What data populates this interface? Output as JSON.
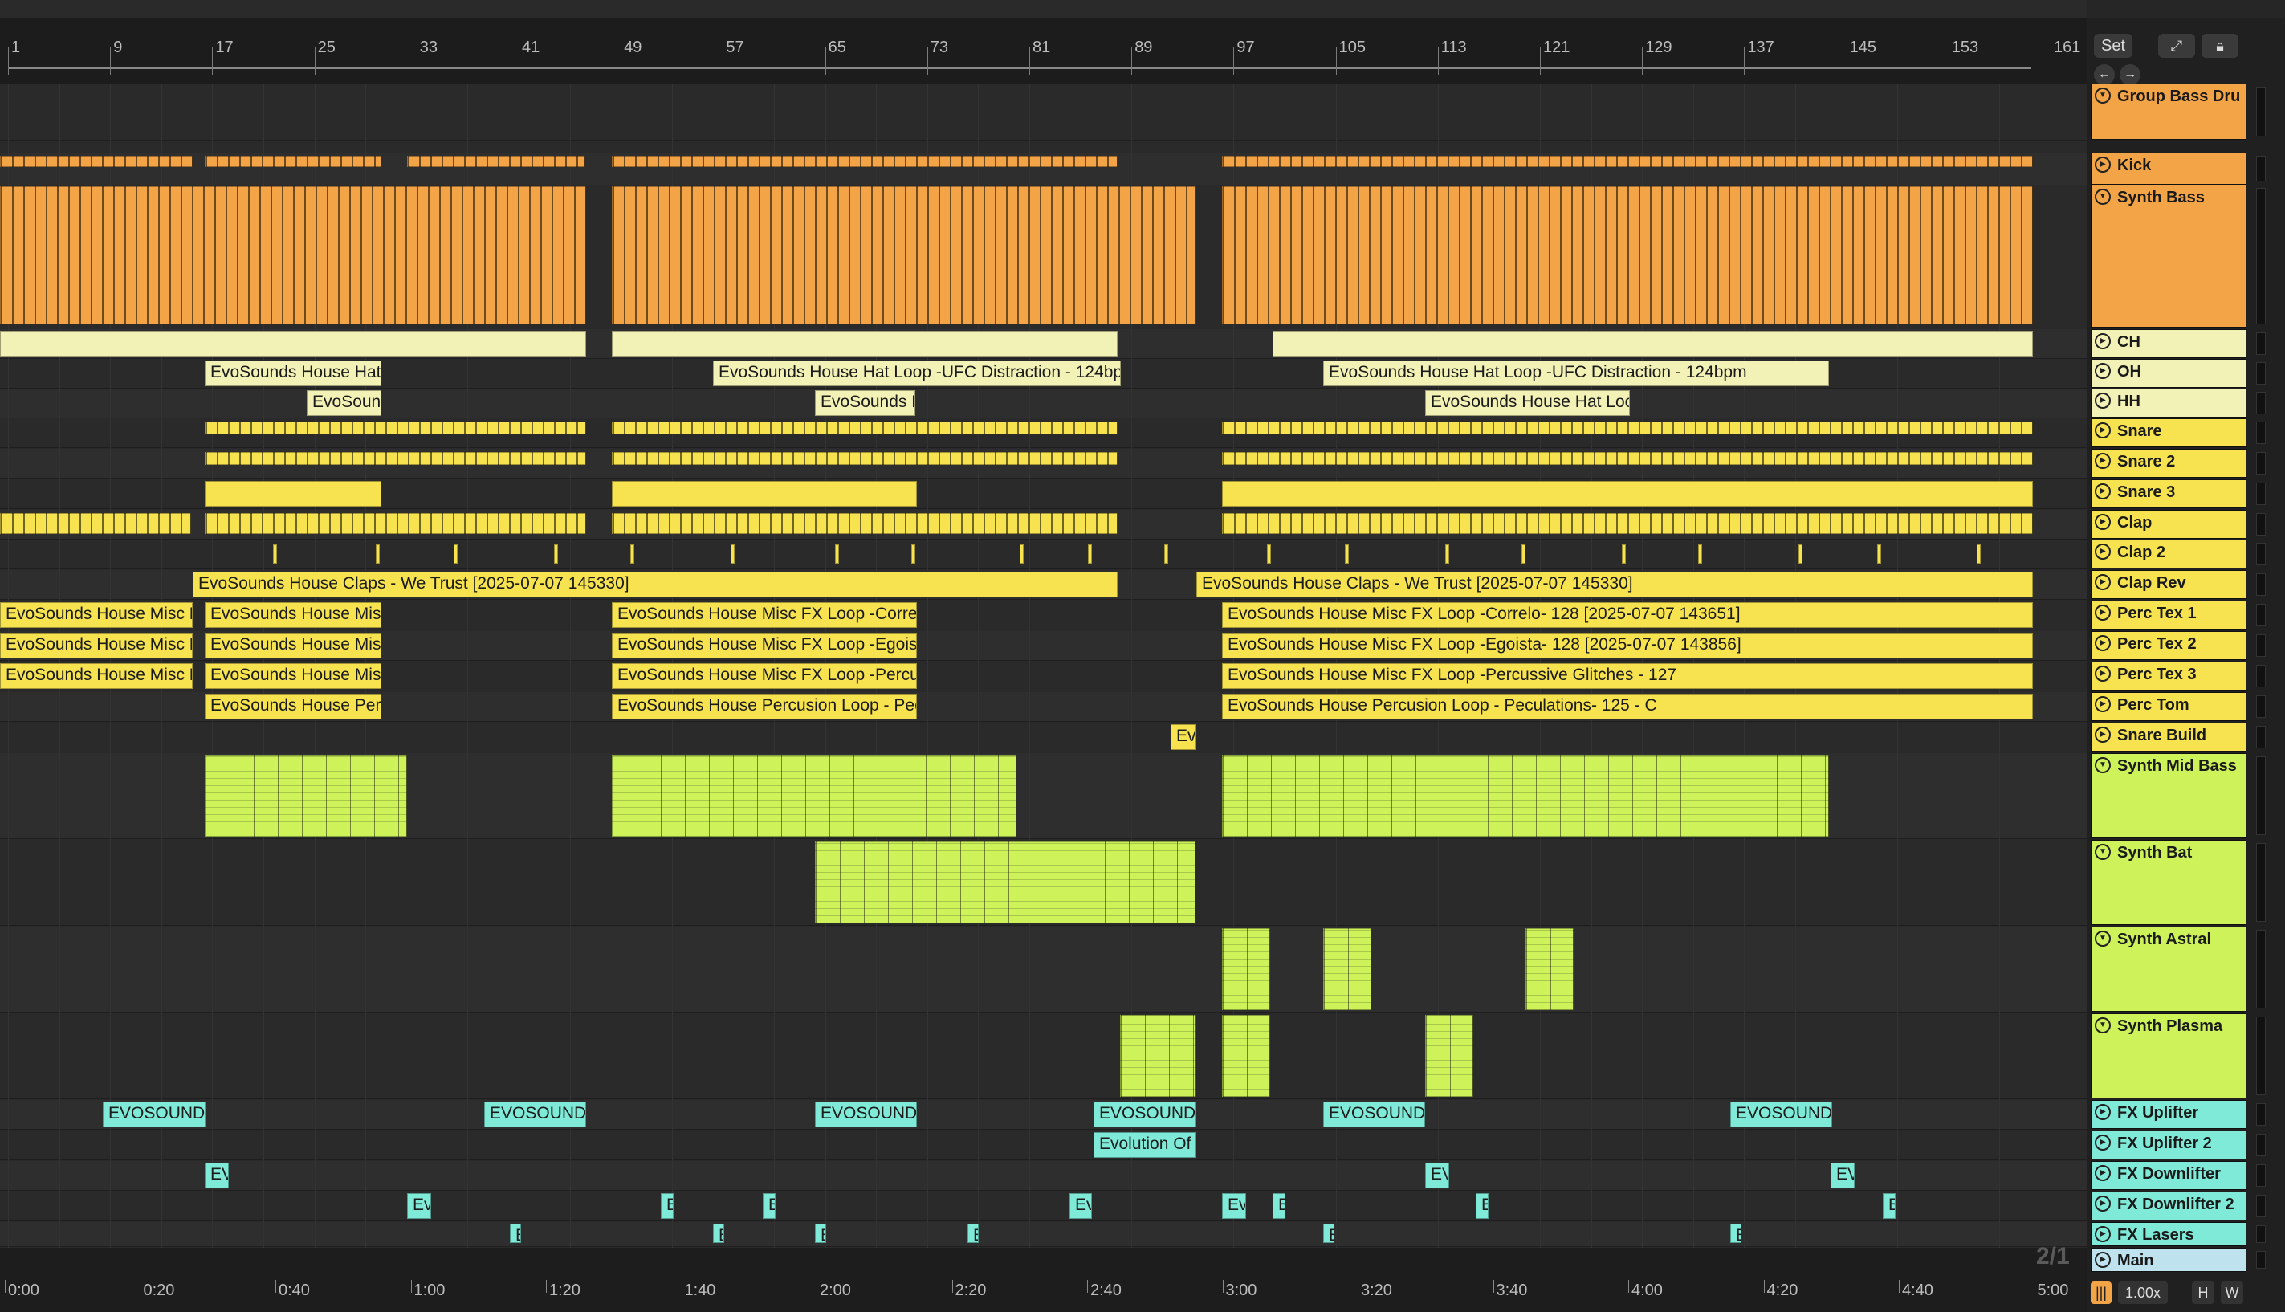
{
  "ruler": {
    "bar_numbers": [
      "1",
      "9",
      "17",
      "25",
      "33",
      "41",
      "49",
      "57",
      "65",
      "73",
      "81",
      "89",
      "97",
      "105",
      "113",
      "121",
      "129",
      "137",
      "145",
      "153",
      "161"
    ]
  },
  "timeline": {
    "times": [
      "0:00",
      "0:20",
      "0:40",
      "1:00",
      "1:20",
      "1:40",
      "2:00",
      "2:20",
      "2:40",
      "3:00",
      "3:20",
      "3:40",
      "4:00",
      "4:20",
      "4:40",
      "5:00"
    ]
  },
  "controls": {
    "set_label": "Set",
    "zoom": "1.00x",
    "h_label": "H",
    "w_label": "W",
    "page_indicator": "2/1"
  },
  "tracks": [
    {
      "name": "Group Bass Dru",
      "color": "#f2a447",
      "icon": "fold-icon",
      "group": true
    },
    {
      "name": "Kick",
      "color": "#f2a447",
      "icon": "play-icon"
    },
    {
      "name": "Synth Bass",
      "color": "#f2a447",
      "icon": "fold-icon"
    },
    {
      "name": "CH",
      "color": "#f3f2b6",
      "icon": "play-icon"
    },
    {
      "name": "OH",
      "color": "#f3f2b6",
      "icon": "play-icon"
    },
    {
      "name": "HH",
      "color": "#f3f2b6",
      "icon": "play-icon"
    },
    {
      "name": "Snare",
      "color": "#f7e350",
      "icon": "play-icon"
    },
    {
      "name": "Snare 2",
      "color": "#f7e350",
      "icon": "play-icon"
    },
    {
      "name": "Snare 3",
      "color": "#f7e350",
      "icon": "play-icon"
    },
    {
      "name": "Clap",
      "color": "#f7e350",
      "icon": "play-icon"
    },
    {
      "name": "Clap 2",
      "color": "#f7e350",
      "icon": "play-icon"
    },
    {
      "name": "Clap Rev",
      "color": "#f7e350",
      "icon": "play-icon"
    },
    {
      "name": "Perc Tex 1",
      "color": "#f7e350",
      "icon": "play-icon"
    },
    {
      "name": "Perc Tex 2",
      "color": "#f7e350",
      "icon": "play-icon"
    },
    {
      "name": "Perc Tex 3",
      "color": "#f7e350",
      "icon": "play-icon"
    },
    {
      "name": "Perc Tom",
      "color": "#f7e350",
      "icon": "play-icon"
    },
    {
      "name": "Snare Build",
      "color": "#f7e350",
      "icon": "play-icon"
    },
    {
      "name": "Synth Mid Bass",
      "color": "#cdf25a",
      "icon": "fold-icon"
    },
    {
      "name": "Synth Bat",
      "color": "#cdf25a",
      "icon": "fold-icon"
    },
    {
      "name": "Synth Astral",
      "color": "#cdf25a",
      "icon": "fold-icon"
    },
    {
      "name": "Synth Plasma",
      "color": "#cdf25a",
      "icon": "fold-icon"
    },
    {
      "name": "FX Uplifter",
      "color": "#7eead7",
      "icon": "play-icon"
    },
    {
      "name": "FX Uplifter 2",
      "color": "#7eead7",
      "icon": "play-icon"
    },
    {
      "name": "FX Downlifter",
      "color": "#7eead7",
      "icon": "play-icon"
    },
    {
      "name": "FX Downlifter 2",
      "color": "#7eead7",
      "icon": "play-icon"
    },
    {
      "name": "FX Lasers",
      "color": "#7eead7",
      "icon": "play-icon"
    },
    {
      "name": "Main",
      "color": "#bfe3ee",
      "icon": "play-icon"
    }
  ],
  "clip_labels": {
    "hat_a": "EvoSounds House Hat",
    "hat_b": "EvoSounds House Hat Loop -UFC Distraction - 124bp",
    "hat_c": "EvoSounds House Hat Loop -UFC Distraction - 124bpm",
    "hh_a": "EvoSound",
    "hh_b": "EvoSounds H",
    "hh_c": "EvoSounds House Hat Loo",
    "claps_a": "EvoSounds House Claps - We Trust  [2025-07-07 145330]",
    "claps_b": "EvoSounds House Claps - We Trust  [2025-07-07 145330]",
    "p1_a": "EvoSounds House Misc F",
    "p1_b": "EvoSounds House Misc",
    "p1_c": "EvoSounds House Misc FX Loop -Correl",
    "p1_d": "EvoSounds House Misc FX Loop -Correlo- 128 [2025-07-07 143651]",
    "p2_a": "EvoSounds House Misc F",
    "p2_b": "EvoSounds House Misc",
    "p2_c": "EvoSounds House Misc FX Loop -Egoist",
    "p2_d": "EvoSounds House Misc FX Loop -Egoista- 128 [2025-07-07 143856]",
    "p3_a": "EvoSounds House Misc F",
    "p3_b": "EvoSounds House Misc",
    "p3_c": "EvoSounds House Misc FX Loop -Percus",
    "p3_d": "EvoSounds House Misc FX Loop -Percussive Glitches - 127",
    "tom_a": "EvoSounds House Perc",
    "tom_b": "EvoSounds House Percusion Loop - Pec",
    "tom_c": "EvoSounds House Percusion Loop - Peculations- 125 - C",
    "build": "Ev",
    "evosounds": "EVOSOUNDS",
    "evolution": "Evolution Of",
    "ev": "EV",
    "ev2": "Ev",
    "e": "E"
  }
}
